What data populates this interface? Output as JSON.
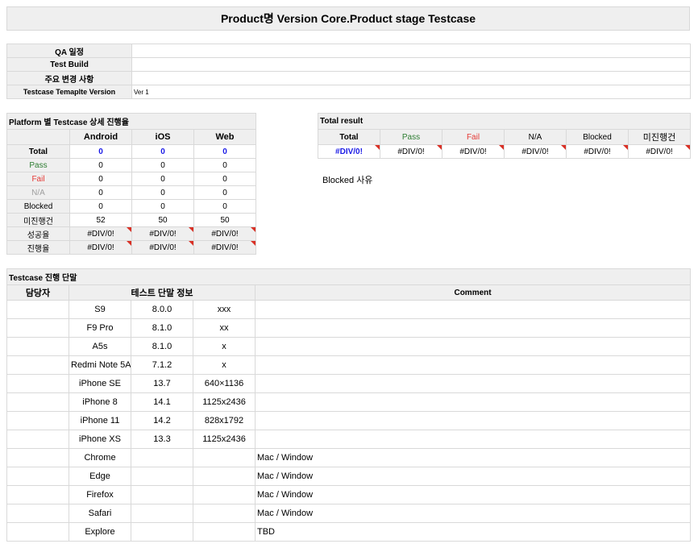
{
  "header": {
    "title": "Product명 Version Core.Product stage Testcase"
  },
  "info": {
    "rows": [
      {
        "label": "QA 일정",
        "value": ""
      },
      {
        "label": "Test Build",
        "value": ""
      },
      {
        "label": "주요 변경 사항",
        "value": ""
      },
      {
        "label": "Testcase Temaplte Version",
        "value": "Ver 1"
      }
    ]
  },
  "platform": {
    "title": "Platform 별 Testcase 상세 진행율",
    "columns": [
      "Android",
      "iOS",
      "Web"
    ],
    "rows": [
      {
        "label": "Total",
        "values": [
          "0",
          "0",
          "0"
        ]
      },
      {
        "label": "Pass",
        "values": [
          "0",
          "0",
          "0"
        ]
      },
      {
        "label": "Fail",
        "values": [
          "0",
          "0",
          "0"
        ]
      },
      {
        "label": "N/A",
        "values": [
          "0",
          "0",
          "0"
        ]
      },
      {
        "label": "Blocked",
        "values": [
          "0",
          "0",
          "0"
        ]
      },
      {
        "label": "미진행건",
        "values": [
          "52",
          "50",
          "50"
        ]
      },
      {
        "label": "성공율",
        "values": [
          "#DIV/0!",
          "#DIV/0!",
          "#DIV/0!"
        ]
      },
      {
        "label": "진행율",
        "values": [
          "#DIV/0!",
          "#DIV/0!",
          "#DIV/0!"
        ]
      }
    ]
  },
  "total_result": {
    "title": "Total result",
    "headers": [
      "Total",
      "Pass",
      "Fail",
      "N/A",
      "Blocked",
      "미진행건"
    ],
    "values": [
      "#DIV/0!",
      "#DIV/0!",
      "#DIV/0!",
      "#DIV/0!",
      "#DIV/0!",
      "#DIV/0!"
    ]
  },
  "blocked": {
    "label": "Blocked 사유"
  },
  "devices": {
    "title": "Testcase 진행 단말",
    "headers": {
      "owner": "담당자",
      "info": "테스트 단말 정보",
      "comment": "Comment"
    },
    "rows": [
      {
        "name": "S9",
        "os": "8.0.0",
        "res": "xxx",
        "comment": ""
      },
      {
        "name": "F9 Pro",
        "os": "8.1.0",
        "res": "xx",
        "comment": ""
      },
      {
        "name": "A5s",
        "os": "8.1.0",
        "res": "x",
        "comment": ""
      },
      {
        "name": "Redmi Note 5A",
        "os": "7.1.2",
        "res": "x",
        "comment": ""
      },
      {
        "name": "iPhone SE",
        "os": "13.7",
        "res": "640×1136",
        "comment": ""
      },
      {
        "name": "iPhone 8",
        "os": "14.1",
        "res": "1125x2436",
        "comment": ""
      },
      {
        "name": "iPhone 11",
        "os": "14.2",
        "res": "828x1792",
        "comment": ""
      },
      {
        "name": "iPhone XS",
        "os": "13.3",
        "res": "1125x2436",
        "comment": ""
      },
      {
        "name": "Chrome",
        "os": "",
        "res": "",
        "comment": "Mac / Window"
      },
      {
        "name": "Edge",
        "os": "",
        "res": "",
        "comment": "Mac / Window"
      },
      {
        "name": "Firefox",
        "os": "",
        "res": "",
        "comment": "Mac / Window"
      },
      {
        "name": "Safari",
        "os": "",
        "res": "",
        "comment": "Mac / Window"
      },
      {
        "name": "Explore",
        "os": "",
        "res": "",
        "comment": "TBD"
      }
    ]
  }
}
